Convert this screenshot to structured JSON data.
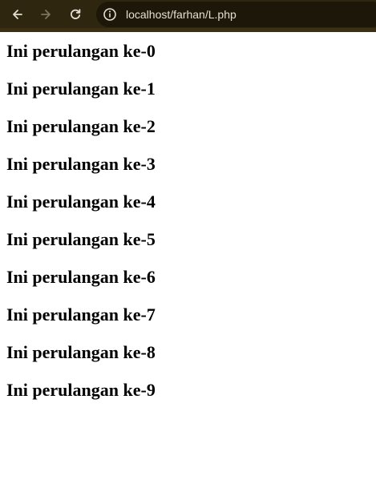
{
  "browser": {
    "url": "localhost/farhan/L.php",
    "colors": {
      "toolbar": "#2f2610",
      "omnibox": "#1d1709",
      "icon": "#e3dfd2",
      "icon_disabled": "#7d745d"
    },
    "icons": [
      "back-arrow-icon",
      "forward-arrow-icon",
      "reload-icon",
      "site-info-icon"
    ]
  },
  "page": {
    "lines": [
      "Ini perulangan ke-0",
      "Ini perulangan ke-1",
      "Ini perulangan ke-2",
      "Ini perulangan ke-3",
      "Ini perulangan ke-4",
      "Ini perulangan ke-5",
      "Ini perulangan ke-6",
      "Ini perulangan ke-7",
      "Ini perulangan ke-8",
      "Ini perulangan ke-9"
    ]
  }
}
